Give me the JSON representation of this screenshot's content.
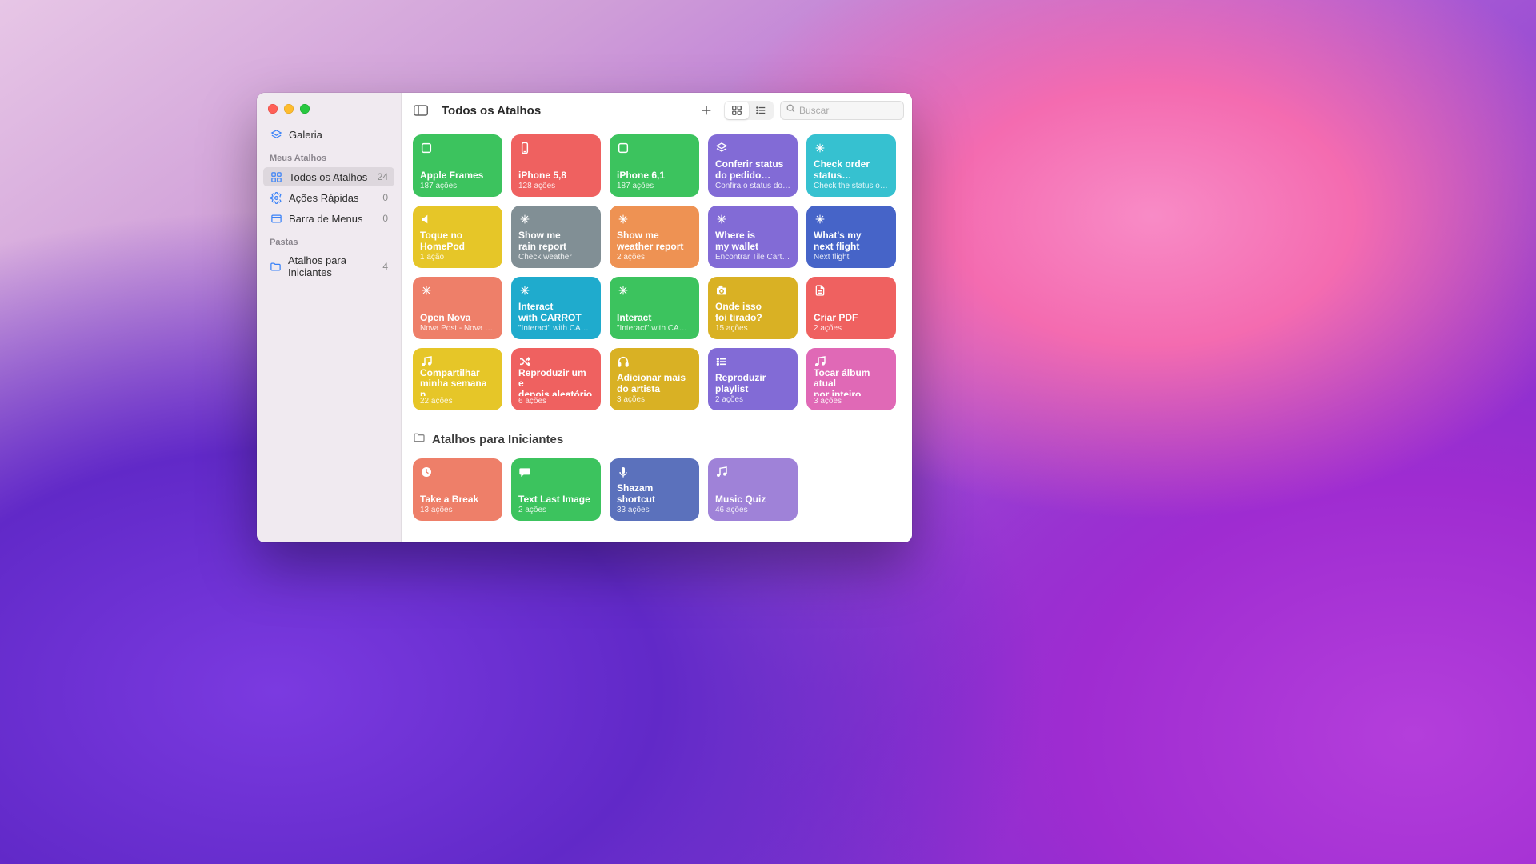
{
  "header": {
    "title": "Todos os Atalhos",
    "search_placeholder": "Buscar"
  },
  "sidebar": {
    "gallery": "Galeria",
    "cat_my": "Meus Atalhos",
    "cat_folders": "Pastas",
    "items": [
      {
        "label": "Todos os Atalhos",
        "count": "24",
        "icon": "grid",
        "selected": true
      },
      {
        "label": "Ações Rápidas",
        "count": "0",
        "icon": "gear",
        "selected": false
      },
      {
        "label": "Barra de Menus",
        "count": "0",
        "icon": "window",
        "selected": false
      }
    ],
    "folders": [
      {
        "label": "Atalhos para Iniciantes",
        "count": "4"
      }
    ]
  },
  "colors": {
    "green": "#3cc35e",
    "red": "#ef6160",
    "purple": "#826bd6",
    "teal": "#36c1d0",
    "yellow": "#e6c628",
    "gray": "#818f95",
    "orange": "#ee9253",
    "indigo": "#4664c8",
    "salmon": "#ee7f69",
    "cyan": "#1fabcd",
    "mustard": "#d9b124",
    "lightpurple": "#9f82d8",
    "pink": "#e069b6",
    "blue": "#5b71bc"
  },
  "section2": {
    "title": "Atalhos para Iniciantes"
  },
  "cards": [
    {
      "title": "Apple Frames",
      "sub": "187 ações",
      "color": "green",
      "icon": "square"
    },
    {
      "title": "iPhone 5,8",
      "sub": "128 ações",
      "color": "red",
      "icon": "phone"
    },
    {
      "title": "iPhone 6,1",
      "sub": "187 ações",
      "color": "green",
      "icon": "square"
    },
    {
      "title": "Conferir status\ndo pedido…",
      "sub": "Confira o status dos s…",
      "color": "purple",
      "icon": "layers"
    },
    {
      "title": "Check order\nstatus…",
      "sub": "Check the status of y…",
      "color": "teal",
      "icon": "sparkle"
    },
    {
      "title": "Toque no\nHomePod",
      "sub": "1 ação",
      "color": "yellow",
      "icon": "speaker"
    },
    {
      "title": "Show me\nrain report",
      "sub": "Check weather",
      "color": "gray",
      "icon": "sparkle"
    },
    {
      "title": "Show me\nweather report",
      "sub": "2 ações",
      "color": "orange",
      "icon": "sparkle"
    },
    {
      "title": "Where is\nmy wallet",
      "sub": "Encontrar Tile Carteira",
      "color": "purple",
      "icon": "sparkle"
    },
    {
      "title": "What's my\nnext flight",
      "sub": "Next flight",
      "color": "indigo",
      "icon": "sparkle"
    },
    {
      "title": "Open Nova",
      "sub": "Nova Post - Nova Post",
      "color": "salmon",
      "icon": "sparkle"
    },
    {
      "title": "Interact\nwith CARROT",
      "sub": "\"Interact\" with CARROT",
      "color": "cyan",
      "icon": "sparkle"
    },
    {
      "title": "Interact",
      "sub": "\"Interact\" with CARROT",
      "color": "green",
      "icon": "sparkle"
    },
    {
      "title": "Onde isso\nfoi tirado?",
      "sub": "15 ações",
      "color": "mustard",
      "icon": "camera"
    },
    {
      "title": "Criar PDF",
      "sub": "2 ações",
      "color": "red",
      "icon": "doc"
    },
    {
      "title": "Compartilhar\nminha semana n…",
      "sub": "22 ações",
      "color": "yellow",
      "icon": "music"
    },
    {
      "title": "Reproduzir um e\ndepois aleatório",
      "sub": "6 ações",
      "color": "red",
      "icon": "shuffle"
    },
    {
      "title": "Adicionar mais\ndo artista",
      "sub": "3 ações",
      "color": "mustard",
      "icon": "headphones"
    },
    {
      "title": "Reproduzir\nplaylist",
      "sub": "2 ações",
      "color": "purple",
      "icon": "list"
    },
    {
      "title": "Tocar álbum atual\npor inteiro",
      "sub": "3 ações",
      "color": "pink",
      "icon": "music"
    }
  ],
  "cards2": [
    {
      "title": "Take a Break",
      "sub": "13 ações",
      "color": "salmon",
      "icon": "clock"
    },
    {
      "title": "Text Last Image",
      "sub": "2 ações",
      "color": "green",
      "icon": "chat"
    },
    {
      "title": "Shazam shortcut",
      "sub": "33 ações",
      "color": "blue",
      "icon": "mic"
    },
    {
      "title": "Music Quiz",
      "sub": "46 ações",
      "color": "lightpurple",
      "icon": "music"
    }
  ]
}
